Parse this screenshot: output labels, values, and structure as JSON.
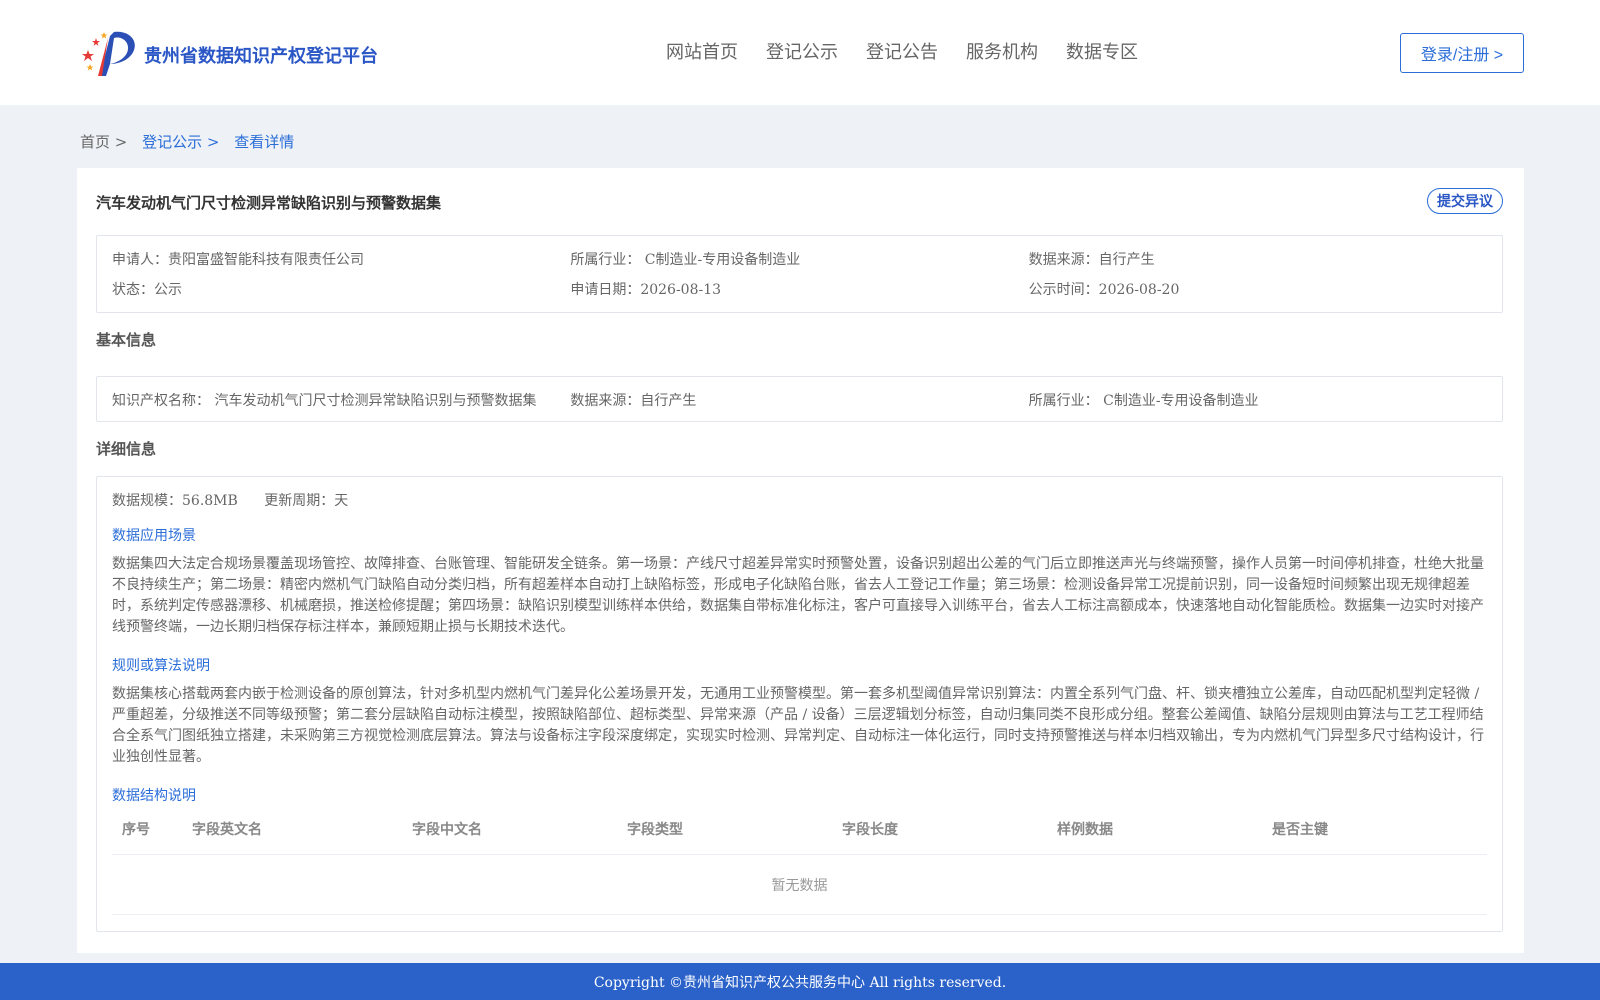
{
  "header": {
    "logo_title": "贵州省数据知识产权登记平台",
    "nav": [
      "网站首页",
      "登记公示",
      "登记公告",
      "服务机构",
      "数据专区"
    ],
    "login_label": "登录/注册 >"
  },
  "breadcrumb": {
    "home": "首页 >",
    "publicity": "登记公示 >",
    "detail": "查看详情"
  },
  "dataset": {
    "title": "汽车发动机气门尺寸检测异常缺陷识别与预警数据集",
    "dispute_label": "提交异议",
    "summary": {
      "applicant": "申请人：贵阳富盛智能科技有限责任公司",
      "industry": "所属行业： C制造业-专用设备制造业",
      "source": "数据来源：自行产生",
      "status": "状态：公示",
      "apply_date": "申请日期：2026-08-13",
      "publicity_date": "公示时间：2026-08-20"
    },
    "basic_heading": "基本信息",
    "basic": {
      "ip_name": "知识产权名称： 汽车发动机气门尺寸检测异常缺陷识别与预警数据集",
      "source": "数据来源：自行产生",
      "industry": "所属行业： C制造业-专用设备制造业"
    },
    "detail_heading": "详细信息",
    "detail": {
      "scale": "数据规模：56.8MB",
      "update_cycle": "更新周期：天",
      "scene_heading": "数据应用场景",
      "scene_text": "数据集四大法定合规场景覆盖现场管控、故障排查、台账管理、智能研发全链条。第一场景：产线尺寸超差异常实时预警处置，设备识别超出公差的气门后立即推送声光与终端预警，操作人员第一时间停机排查，杜绝大批量不良持续生产；第二场景：精密内燃机气门缺陷自动分类归档，所有超差样本自动打上缺陷标签，形成电子化缺陷台账，省去人工登记工作量；第三场景：检测设备异常工况提前识别，同一设备短时间频繁出现无规律超差时，系统判定传感器漂移、机械磨损，推送检修提醒；第四场景：缺陷识别模型训练样本供给，数据集自带标准化标注，客户可直接导入训练平台，省去人工标注高额成本，快速落地自动化智能质检。数据集一边实时对接产线预警终端，一边长期归档保存标注样本，兼顾短期止损与长期技术迭代。",
      "algo_heading": "规则或算法说明",
      "algo_text": "数据集核心搭载两套内嵌于检测设备的原创算法，针对多机型内燃机气门差异化公差场景开发，无通用工业预警模型。第一套多机型阈值异常识别算法：内置全系列气门盘、杆、锁夹槽独立公差库，自动匹配机型判定轻微 / 严重超差，分级推送不同等级预警；第二套分层缺陷自动标注模型，按照缺陷部位、超标类型、异常来源（产品 / 设备）三层逻辑划分标签，自动归集同类不良形成分组。整套公差阈值、缺陷分层规则由算法与工艺工程师结合全系气门图纸独立搭建，未采购第三方视觉检测底层算法。算法与设备标注字段深度绑定，实现实时检测、异常判定、自动标注一体化运行，同时支持预警推送与样本归档双输出，专为内燃机气门异型多尺寸结构设计，行业独创性显著。",
      "structure_heading": "数据结构说明",
      "table_headers": [
        "序号",
        "字段英文名",
        "字段中文名",
        "字段类型",
        "字段长度",
        "样例数据",
        "是否主键"
      ],
      "empty_text": "暂无数据"
    }
  },
  "footer": {
    "copyright": "Copyright ©贵州省知识产权公共服务中心 All rights reserved."
  }
}
